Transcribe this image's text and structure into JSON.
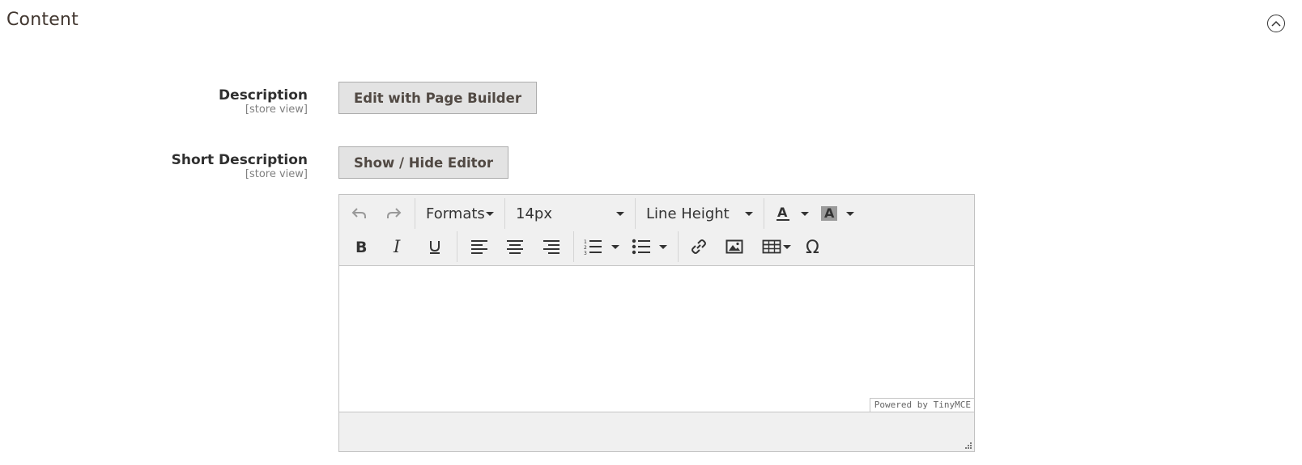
{
  "section": {
    "title": "Content"
  },
  "fields": {
    "description": {
      "label": "Description",
      "scope": "[store view]",
      "button": "Edit with Page Builder"
    },
    "short_description": {
      "label": "Short Description",
      "scope": "[store view]",
      "button": "Show / Hide Editor"
    }
  },
  "editor": {
    "toolbar": {
      "formats_label": "Formats",
      "font_size": "14px",
      "line_height_label": "Line Height"
    },
    "powered_by": "Powered by TinyMCE"
  },
  "icons": [
    "chevron-up-icon",
    "undo-icon",
    "redo-icon",
    "text-color-icon",
    "background-color-icon",
    "bold-icon",
    "italic-icon",
    "underline-icon",
    "align-left-icon",
    "align-center-icon",
    "align-right-icon",
    "numbered-list-icon",
    "bulleted-list-icon",
    "link-icon",
    "image-icon",
    "table-icon",
    "special-character-icon",
    "resize-handle-icon"
  ]
}
